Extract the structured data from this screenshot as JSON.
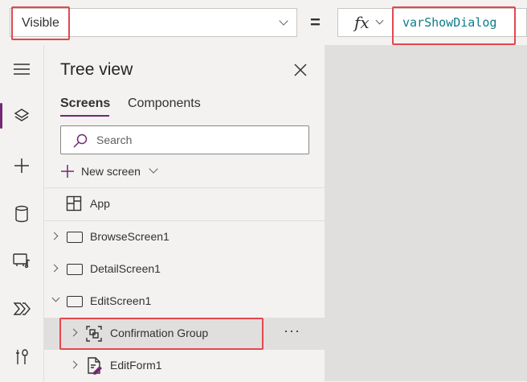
{
  "formula_bar": {
    "property": "Visible",
    "equals": "=",
    "fx_label": "fx",
    "formula": "varShowDialog"
  },
  "rail": {
    "items": [
      {
        "icon": "hamburger-menu-icon",
        "active": false
      },
      {
        "icon": "layers-icon",
        "active": true
      },
      {
        "icon": "plus-icon",
        "active": false
      },
      {
        "icon": "database-icon",
        "active": false
      },
      {
        "icon": "media-icon",
        "active": false
      },
      {
        "icon": "power-automate-icon",
        "active": false
      },
      {
        "icon": "tools-icon",
        "active": false
      }
    ]
  },
  "tree_view": {
    "title": "Tree view",
    "tabs": [
      {
        "label": "Screens",
        "active": true
      },
      {
        "label": "Components",
        "active": false
      }
    ],
    "search_placeholder": "Search",
    "new_screen_label": "New screen",
    "items": [
      {
        "label": "App",
        "icon": "app-icon",
        "chevron": "none",
        "level": 0,
        "selected": false
      },
      {
        "label": "BrowseScreen1",
        "icon": "screen-icon",
        "chevron": "collapsed",
        "level": 0,
        "selected": false
      },
      {
        "label": "DetailScreen1",
        "icon": "screen-icon",
        "chevron": "collapsed",
        "level": 0,
        "selected": false
      },
      {
        "label": "EditScreen1",
        "icon": "screen-icon",
        "chevron": "expanded",
        "level": 0,
        "selected": false
      },
      {
        "label": "Confirmation Group",
        "icon": "group-icon",
        "chevron": "collapsed",
        "level": 1,
        "selected": true
      },
      {
        "label": "EditForm1",
        "icon": "form-icon",
        "chevron": "collapsed",
        "level": 1,
        "selected": false
      }
    ],
    "more_options": "···"
  },
  "colors": {
    "accent": "#742774",
    "highlight": "#e3474f",
    "formula_text": "#0f7b88",
    "canvas": "#e1dfdd"
  }
}
